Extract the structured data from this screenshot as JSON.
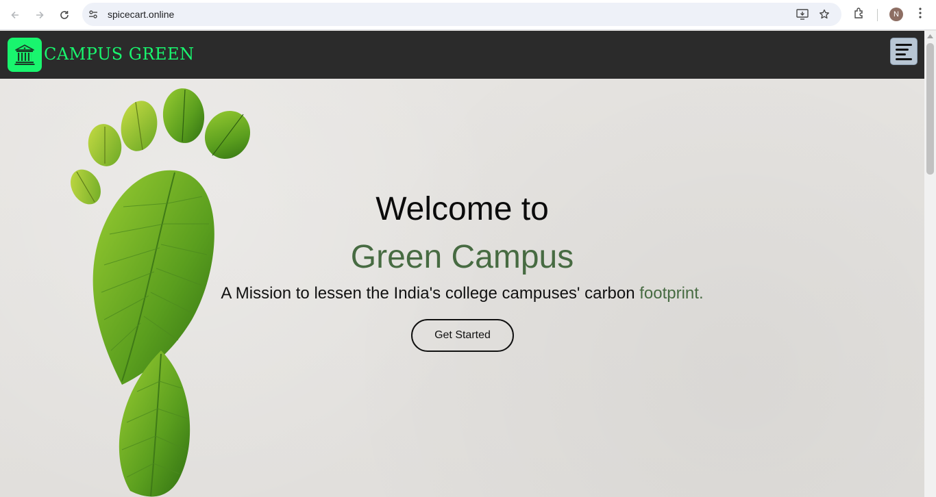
{
  "browser": {
    "url": "spicecart.online",
    "profile_initial": "N"
  },
  "site": {
    "brand": "CAMPUS GREEN",
    "colors": {
      "brand_green": "#19f56e",
      "navbar": "#2b2b2b",
      "accent": "#476b42"
    }
  },
  "hero": {
    "welcome": "Welcome to",
    "title": "Green Campus",
    "mission_text": "A Mission to lessen the India's college campuses' carbon ",
    "mission_accent": "footprint.",
    "cta_label": "Get Started"
  }
}
